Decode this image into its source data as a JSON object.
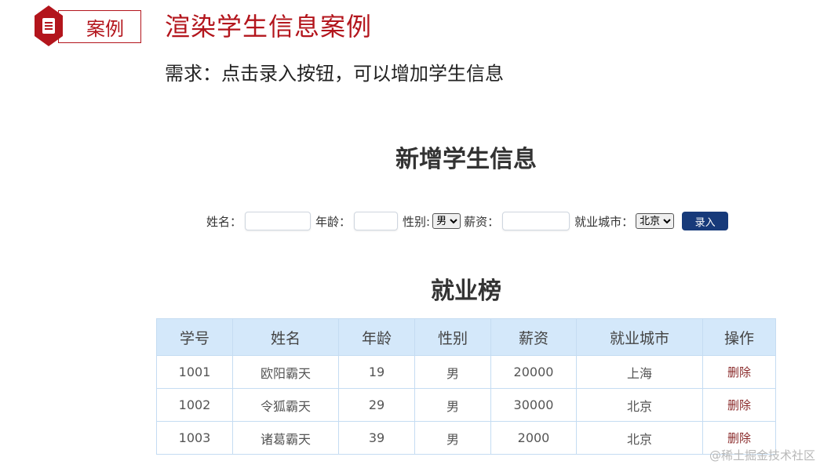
{
  "header": {
    "badge_label": "案例",
    "title": "渲染学生信息案例",
    "requirement": "需求：点击录入按钮，可以增加学生信息"
  },
  "form_section": {
    "heading": "新增学生信息",
    "name_label": "姓名：",
    "age_label": "年龄：",
    "gender_label": "性别:",
    "gender_selected": "男",
    "salary_label": "薪资：",
    "city_label": "就业城市：",
    "city_selected": "北京",
    "submit_label": "录入"
  },
  "table_section": {
    "heading": "就业榜",
    "columns": [
      "学号",
      "姓名",
      "年龄",
      "性别",
      "薪资",
      "就业城市",
      "操作"
    ],
    "rows": [
      {
        "id": "1001",
        "name": "欧阳霸天",
        "age": "19",
        "gender": "男",
        "salary": "20000",
        "city": "上海",
        "action": "删除"
      },
      {
        "id": "1002",
        "name": "令狐霸天",
        "age": "29",
        "gender": "男",
        "salary": "30000",
        "city": "北京",
        "action": "删除"
      },
      {
        "id": "1003",
        "name": "诸葛霸天",
        "age": "39",
        "gender": "男",
        "salary": "2000",
        "city": "北京",
        "action": "删除"
      }
    ]
  },
  "watermark": "@稀土掘金技术社区",
  "colors": {
    "brand_red": "#b3151c",
    "button_blue": "#173a7a",
    "table_header_bg": "#d4e8fa"
  }
}
